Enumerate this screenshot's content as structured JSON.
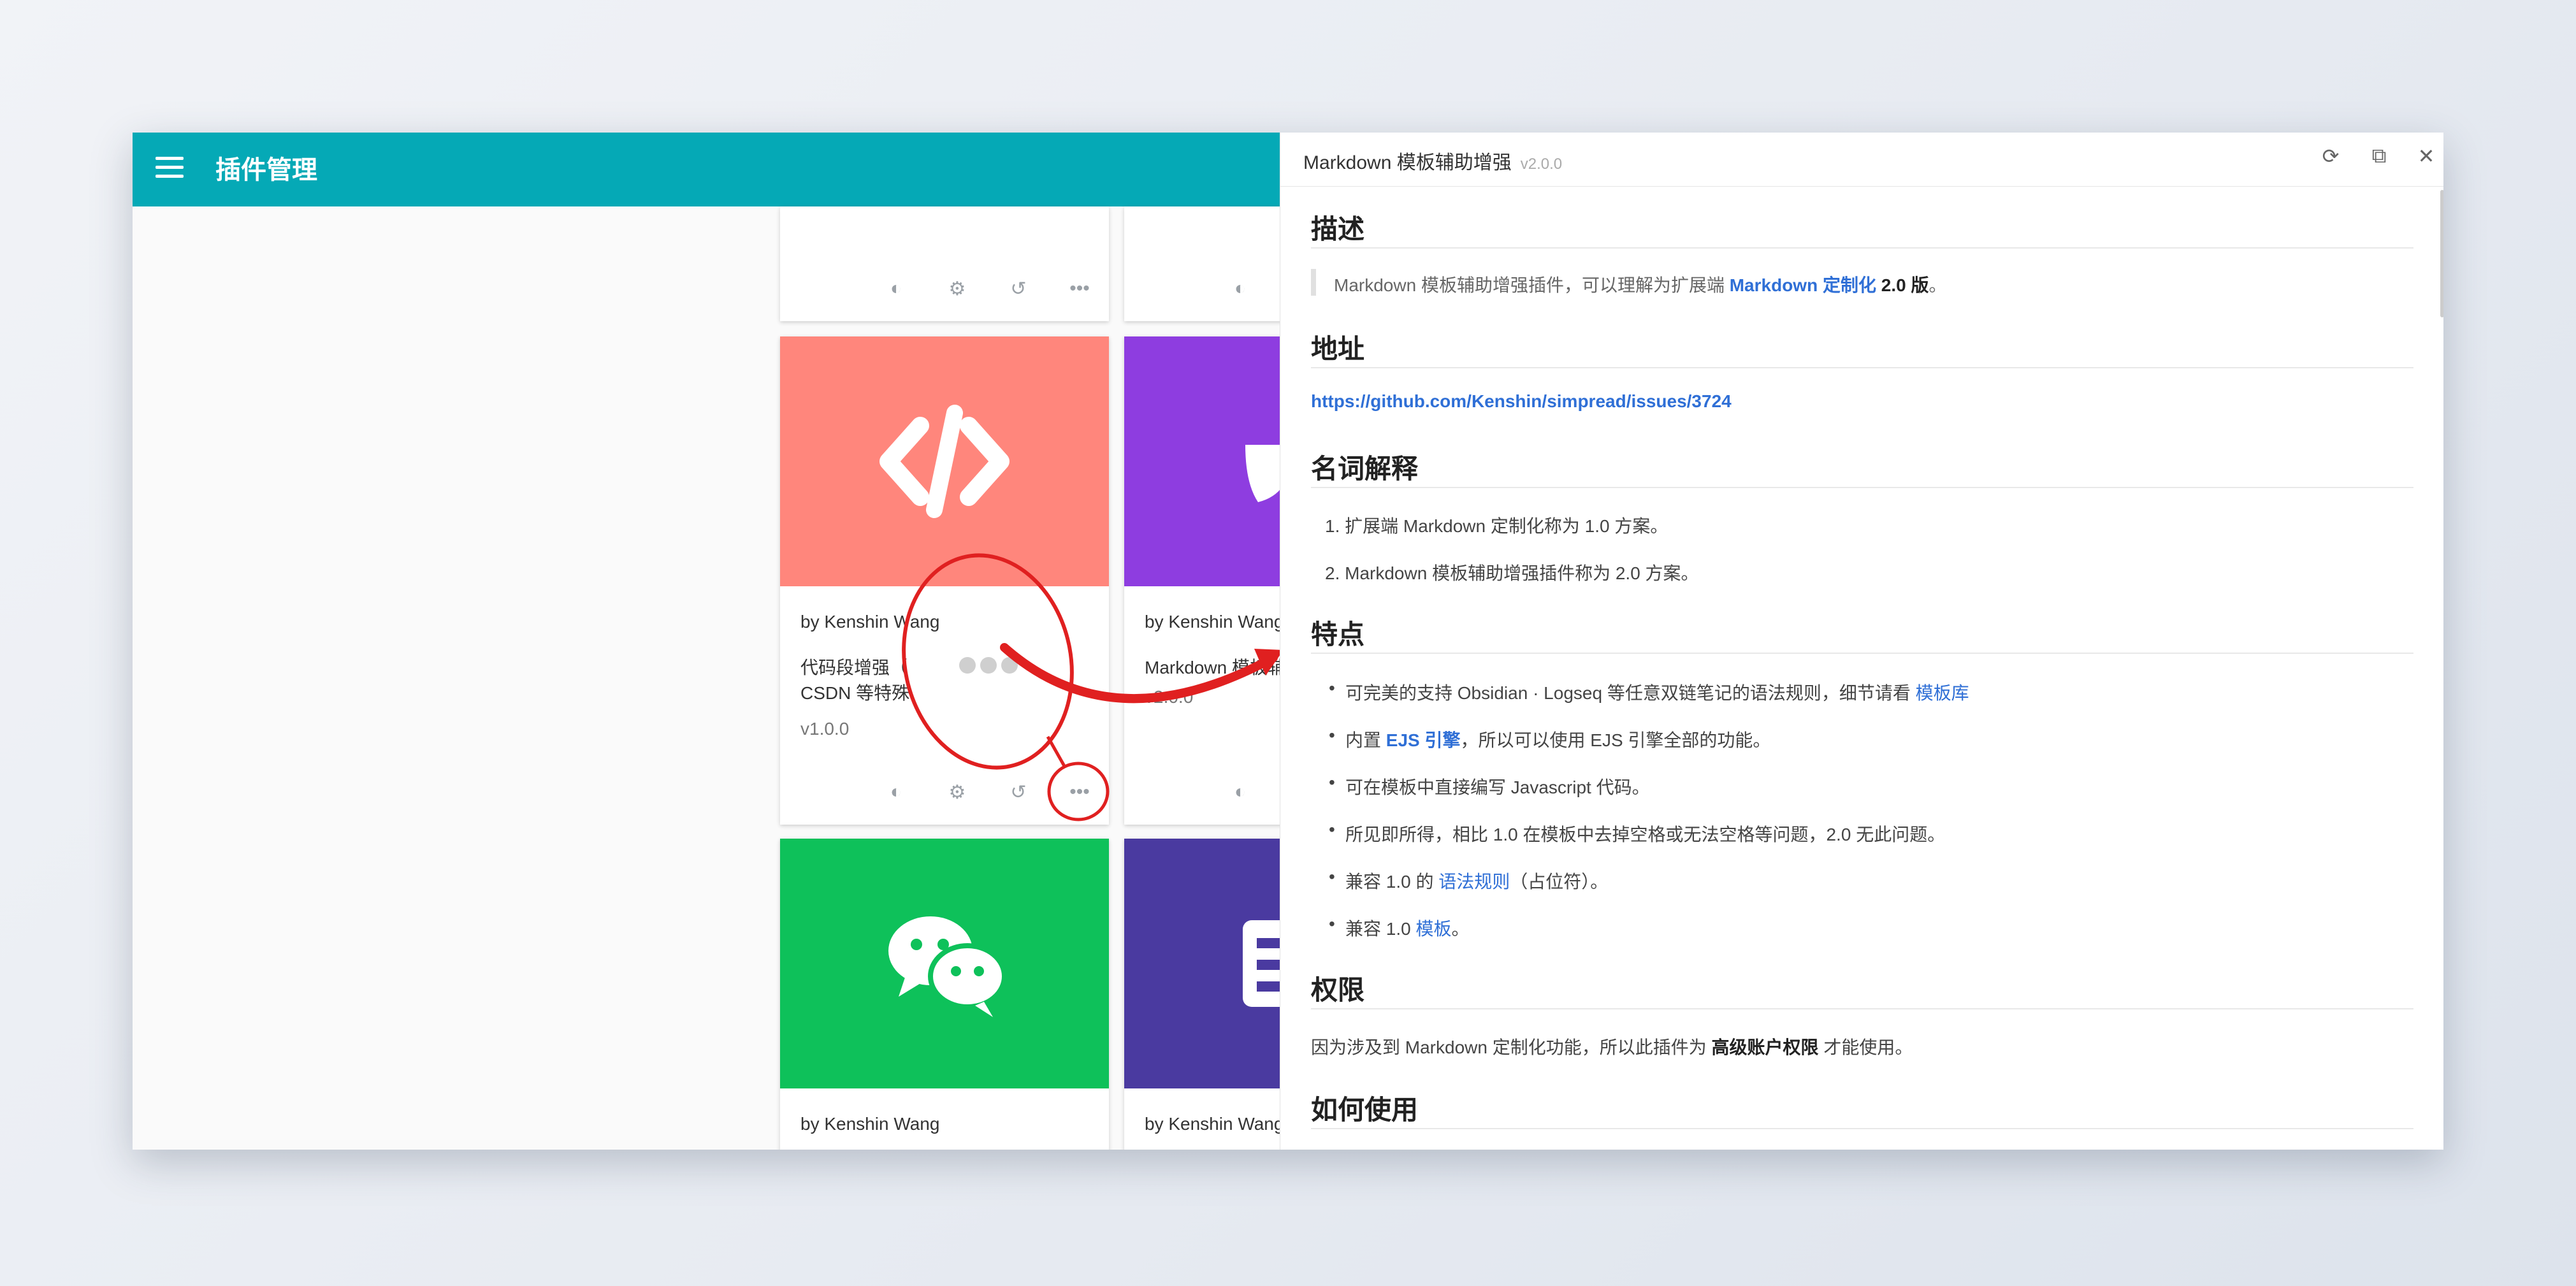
{
  "app": {
    "title": "插件管理"
  },
  "cards": {
    "top_left": {},
    "top_right": {},
    "code": {
      "author": "by Kenshin Wang",
      "desc_line1": "代码段增强（",
      "desc_line2": "CSDN 等特殊",
      "version": "v1.0.0",
      "color": "#ff867c"
    },
    "markdown": {
      "author": "by Kenshin Wang",
      "desc_line1": "Markdown 模板辅",
      "version": "v2.0.0",
      "color": "#8e3de0"
    },
    "wechat": {
      "author": "by Kenshin Wang",
      "color": "#0ec15a"
    },
    "list": {
      "author": "by Kenshin Wang",
      "color": "#4a3aa0"
    }
  },
  "annotation": {
    "color": "#e02020"
  },
  "panel": {
    "title": "Markdown 模板辅助增强",
    "version": "v2.0.0",
    "icons": [
      "refresh-icon",
      "external-link-icon",
      "close-icon"
    ],
    "sections": {
      "desc": {
        "heading": "描述",
        "text_pre": "Markdown 模板辅助增强插件，可以理解为扩展端",
        "link": "Markdown 定制化",
        "text_post_bold": "2.0 版",
        "text_end": "。"
      },
      "address": {
        "heading": "地址",
        "url": "https://github.com/Kenshin/simpread/issues/3724"
      },
      "terms": {
        "heading": "名词解释",
        "items": [
          "1. 扩展端 Markdown 定制化称为 1.0 方案。",
          "2. Markdown 模板辅助增强插件称为 2.0 方案。"
        ]
      },
      "features": {
        "heading": "特点",
        "f1_pre": "可完美的支持 Obsidian · Logseq 等任意双链笔记的语法规则，细节请看",
        "f1_link": "模板库",
        "f2_pre": "内置",
        "f2_link": "EJS 引擎",
        "f2_post": "，所以可以使用 EJS 引擎全部的功能。",
        "f3": "可在模板中直接编写 Javascript 代码。",
        "f4": "所见即所得，相比 1.0 在模板中去掉空格或无法空格等问题，2.0 无此问题。",
        "f5_pre": "兼容 1.0 的",
        "f5_link": "语法规则",
        "f5_post": "（占位符）。",
        "f6_pre": "兼容 1.0",
        "f6_link": "模板",
        "f6_post": "。"
      },
      "permission": {
        "heading": "权限",
        "text_pre": "因为涉及到 Markdown 定制化功能，所以此插件为",
        "bold": "高级账户权限",
        "text_post": "才能使用。"
      },
      "usage": {
        "heading": "如何使用"
      }
    }
  }
}
